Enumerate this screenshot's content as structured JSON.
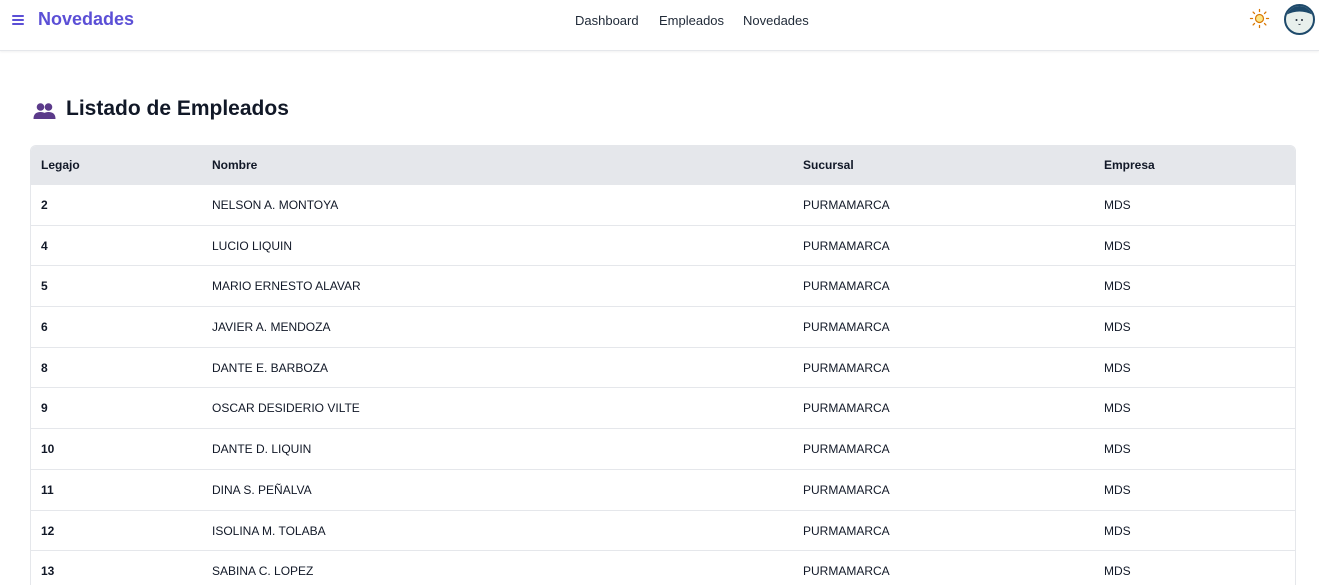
{
  "app": {
    "title": "Novedades",
    "accent_color": "#5b4fd6"
  },
  "nav": {
    "links": [
      "Dashboard",
      "Empleados",
      "Novedades"
    ]
  },
  "toolbar": {
    "menu_icon": "hamburger-menu-icon",
    "theme_icon": "sun-icon",
    "avatar_icon": "user-avatar"
  },
  "page": {
    "heading_icon": "users-icon",
    "heading": "Listado de Empleados"
  },
  "table": {
    "headers": [
      "Legajo",
      "Nombre",
      "Sucursal",
      "Empresa"
    ],
    "rows": [
      [
        "2",
        "NELSON A. MONTOYA",
        "PURMAMARCA",
        "MDS"
      ],
      [
        "4",
        "LUCIO LIQUIN",
        "PURMAMARCA",
        "MDS"
      ],
      [
        "5",
        "MARIO ERNESTO ALAVAR",
        "PURMAMARCA",
        "MDS"
      ],
      [
        "6",
        "JAVIER A. MENDOZA",
        "PURMAMARCA",
        "MDS"
      ],
      [
        "8",
        "DANTE E. BARBOZA",
        "PURMAMARCA",
        "MDS"
      ],
      [
        "9",
        "OSCAR DESIDERIO VILTE",
        "PURMAMARCA",
        "MDS"
      ],
      [
        "10",
        "DANTE D. LIQUIN",
        "PURMAMARCA",
        "MDS"
      ],
      [
        "11",
        "DINA S. PEÑALVA",
        "PURMAMARCA",
        "MDS"
      ],
      [
        "12",
        "ISOLINA M. TOLABA",
        "PURMAMARCA",
        "MDS"
      ],
      [
        "13",
        "SABINA C. LOPEZ",
        "PURMAMARCA",
        "MDS"
      ]
    ]
  }
}
